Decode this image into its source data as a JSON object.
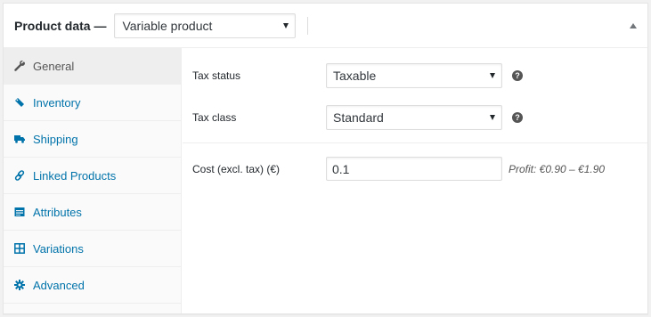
{
  "header": {
    "title": "Product data —",
    "product_type": "Variable product"
  },
  "sidebar": {
    "tabs": [
      {
        "label": "General",
        "icon": "wrench-icon",
        "active": true
      },
      {
        "label": "Inventory",
        "icon": "tag-icon",
        "active": false
      },
      {
        "label": "Shipping",
        "icon": "truck-icon",
        "active": false
      },
      {
        "label": "Linked Products",
        "icon": "link-icon",
        "active": false
      },
      {
        "label": "Attributes",
        "icon": "list-card-icon",
        "active": false
      },
      {
        "label": "Variations",
        "icon": "grid-icon",
        "active": false
      },
      {
        "label": "Advanced",
        "icon": "gear-icon",
        "active": false
      }
    ]
  },
  "general": {
    "tax_status": {
      "label": "Tax status",
      "value": "Taxable",
      "help": "?"
    },
    "tax_class": {
      "label": "Tax class",
      "value": "Standard",
      "help": "?"
    },
    "cost": {
      "label": "Cost (excl. tax) (€)",
      "value": "0.1",
      "profit": "Profit: €0.90 – €1.90"
    }
  },
  "colors": {
    "link": "#0073aa",
    "active_tab_bg": "#eeeeee",
    "border": "#dddddd"
  }
}
